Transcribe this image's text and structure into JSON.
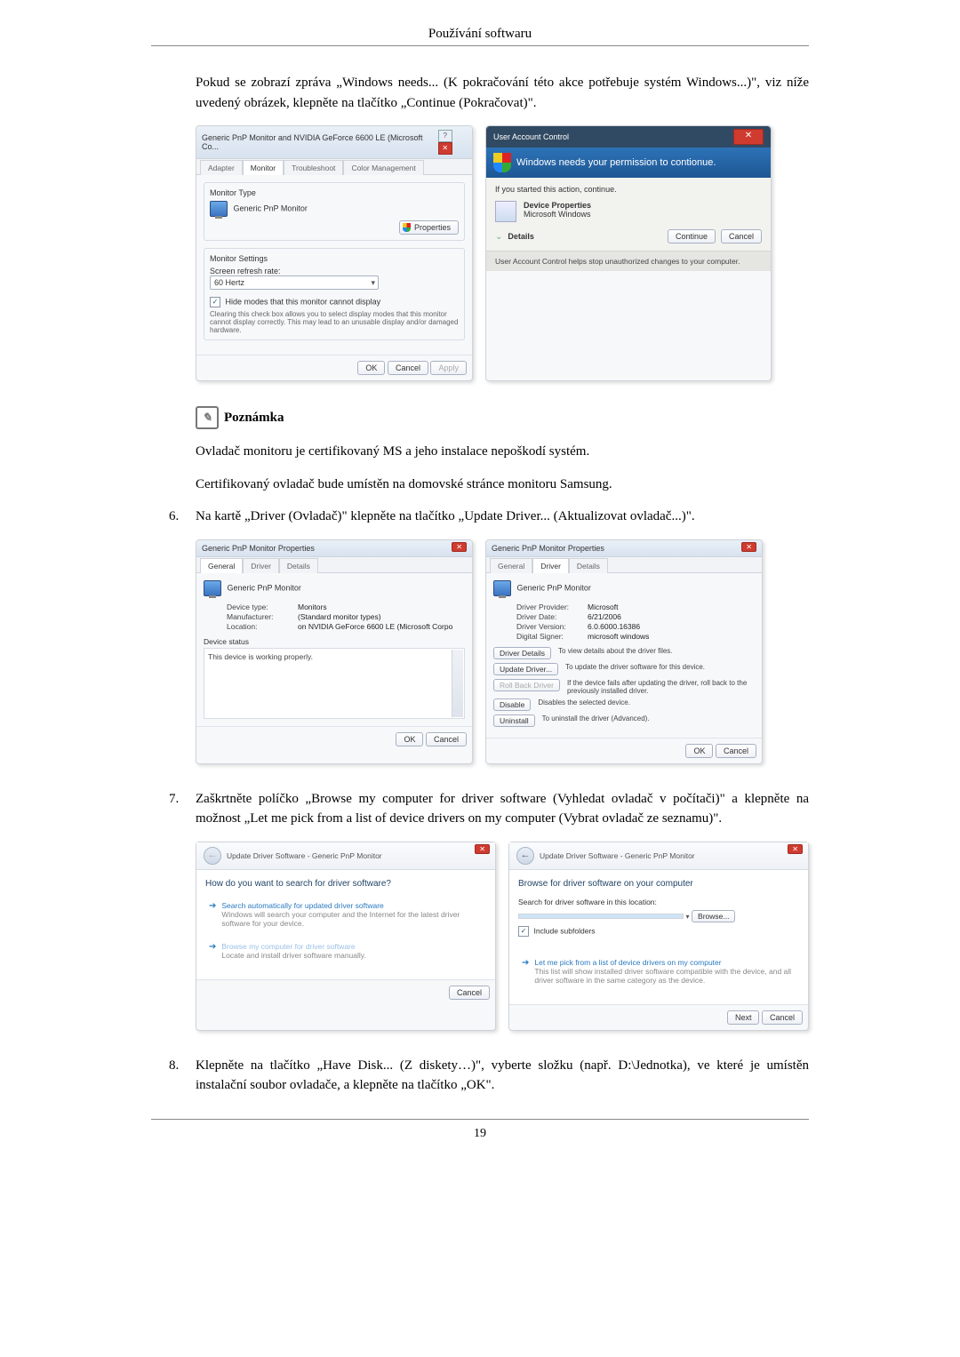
{
  "header": "Používání softwaru",
  "intro": "Pokud se zobrazí zpráva „Windows needs... (K pokračování této akce potřebuje systém Windows...)\", viz níže uvedený obrázek, klepněte na tlačítko „Continue (Pokračovat)\".",
  "dlg_monitor": {
    "title": "Generic PnP Monitor and NVIDIA GeForce 6600 LE (Microsoft Co...",
    "tabs": [
      "Adapter",
      "Monitor",
      "Troubleshoot",
      "Color Management"
    ],
    "monitor_type_label": "Monitor Type",
    "monitor_name": "Generic PnP Monitor",
    "properties_btn": "Properties",
    "monitor_settings_label": "Monitor Settings",
    "refresh_label": "Screen refresh rate:",
    "refresh_value": "60 Hertz",
    "hide_checkbox": "Hide modes that this monitor cannot display",
    "hide_desc": "Clearing this check box allows you to select display modes that this monitor cannot display correctly. This may lead to an unusable display and/or damaged hardware.",
    "ok": "OK",
    "cancel": "Cancel",
    "apply": "Apply"
  },
  "uac": {
    "header": "User Account Control",
    "message": "Windows needs your permission to contionue.",
    "sub1": "If you started this action, continue.",
    "app_name": "Device Properties",
    "app_vendor": "Microsoft Windows",
    "details": "Details",
    "continue": "Continue",
    "cancel": "Cancel",
    "footer": "User Account Control helps stop unauthorized changes to your computer."
  },
  "note_label": "Poznámka",
  "note_p1": "Ovladač monitoru je certifikovaný MS a jeho instalace nepoškodí systém.",
  "note_p2": "Certifikovaný ovladač bude umístěn na domovské stránce monitoru Samsung.",
  "step6": "Na kartě „Driver (Ovladač)\" klepněte na tlačítko „Update Driver... (Aktualizovat ovladač...)\".",
  "prop_general": {
    "title": "Generic PnP Monitor Properties",
    "tabs": [
      "General",
      "Driver",
      "Details"
    ],
    "name": "Generic PnP Monitor",
    "rows": [
      [
        "Device type:",
        "Monitors"
      ],
      [
        "Manufacturer:",
        "(Standard monitor types)"
      ],
      [
        "Location:",
        "on NVIDIA GeForce 6600 LE (Microsoft Corpo"
      ]
    ],
    "status_label": "Device status",
    "status_text": "This device is working properly.",
    "ok": "OK",
    "cancel": "Cancel"
  },
  "prop_driver": {
    "title": "Generic PnP Monitor Properties",
    "tabs": [
      "General",
      "Driver",
      "Details"
    ],
    "name": "Generic PnP Monitor",
    "rows": [
      [
        "Driver Provider:",
        "Microsoft"
      ],
      [
        "Driver Date:",
        "6/21/2006"
      ],
      [
        "Driver Version:",
        "6.0.6000.16386"
      ],
      [
        "Digital Signer:",
        "microsoft windows"
      ]
    ],
    "actions": [
      [
        "Driver Details",
        "To view details about the driver files."
      ],
      [
        "Update Driver...",
        "To update the driver software for this device."
      ],
      [
        "Roll Back Driver",
        "If the device fails after updating the driver, roll back to the previously installed driver."
      ],
      [
        "Disable",
        "Disables the selected device."
      ],
      [
        "Uninstall",
        "To uninstall the driver (Advanced)."
      ]
    ],
    "ok": "OK",
    "cancel": "Cancel"
  },
  "step7": "Zaškrtněte políčko „Browse my computer for driver software (Vyhledat ovladač v počítači)\" a klepněte na možnost „Let me pick from a list of device drivers on my computer (Vybrat ovladač ze seznamu)\".",
  "wizard1": {
    "crumb": "Update Driver Software - Generic PnP Monitor",
    "heading": "How do you want to search for driver software?",
    "opt1_title": "Search automatically for updated driver software",
    "opt1_sub": "Windows will search your computer and the Internet for the latest driver software for your device.",
    "opt2_title": "Browse my computer for driver software",
    "opt2_sub": "Locate and install driver software manually.",
    "cancel": "Cancel"
  },
  "wizard2": {
    "crumb": "Update Driver Software - Generic PnP Monitor",
    "heading": "Browse for driver software on your computer",
    "loc_label": "Search for driver software in this location:",
    "loc_value": "",
    "browse": "Browse...",
    "include": "Include subfolders",
    "pick_title": "Let me pick from a list of device drivers on my computer",
    "pick_sub": "This list will show installed driver software compatible with the device, and all driver software in the same category as the device.",
    "next": "Next",
    "cancel": "Cancel"
  },
  "step8": "Klepněte na tlačítko „Have Disk... (Z diskety…)\", vyberte složku (např. D:\\Jednotka), ve které je umístěn instalační soubor ovladače, a klepněte na tlačítko „OK\".",
  "page_number": "19"
}
